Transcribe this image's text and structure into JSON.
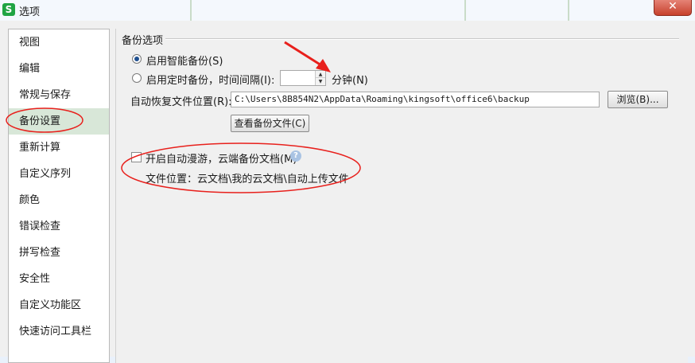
{
  "window": {
    "title": "选项",
    "app_icon_letter": "S",
    "close_symbol": "✕"
  },
  "sidebar": {
    "items": [
      {
        "label": "视图"
      },
      {
        "label": "编辑"
      },
      {
        "label": "常规与保存"
      },
      {
        "label": "备份设置",
        "selected": true
      },
      {
        "label": "重新计算"
      },
      {
        "label": "自定义序列"
      },
      {
        "label": "颜色"
      },
      {
        "label": "错误检查"
      },
      {
        "label": "拼写检查"
      },
      {
        "label": "安全性"
      },
      {
        "label": "自定义功能区"
      },
      {
        "label": "快速访问工具栏"
      }
    ]
  },
  "backup": {
    "group_title": "备份选项",
    "smart_backup_label": "启用智能备份(S)",
    "timed_backup_label": "启用定时备份，时间间隔(I):",
    "interval_value": "",
    "minutes_label": "分钟(N)",
    "path_label": "自动恢复文件位置(R):",
    "path_value": "C:\\Users\\8B854N2\\AppData\\Roaming\\kingsoft\\office6\\backup",
    "browse_label": "浏览(B)...",
    "view_backup_label": "查看备份文件(C)",
    "roaming_label": "开启自动漫游，云端备份文档(M)",
    "help_symbol": "?",
    "file_location_label": "文件位置：云文档\\我的云文档\\自动上传文件",
    "selected_option": "smart"
  },
  "colors": {
    "annotation_red": "#e8201c",
    "selected_bg": "#d8e7d8",
    "app_icon": "#20a443"
  }
}
